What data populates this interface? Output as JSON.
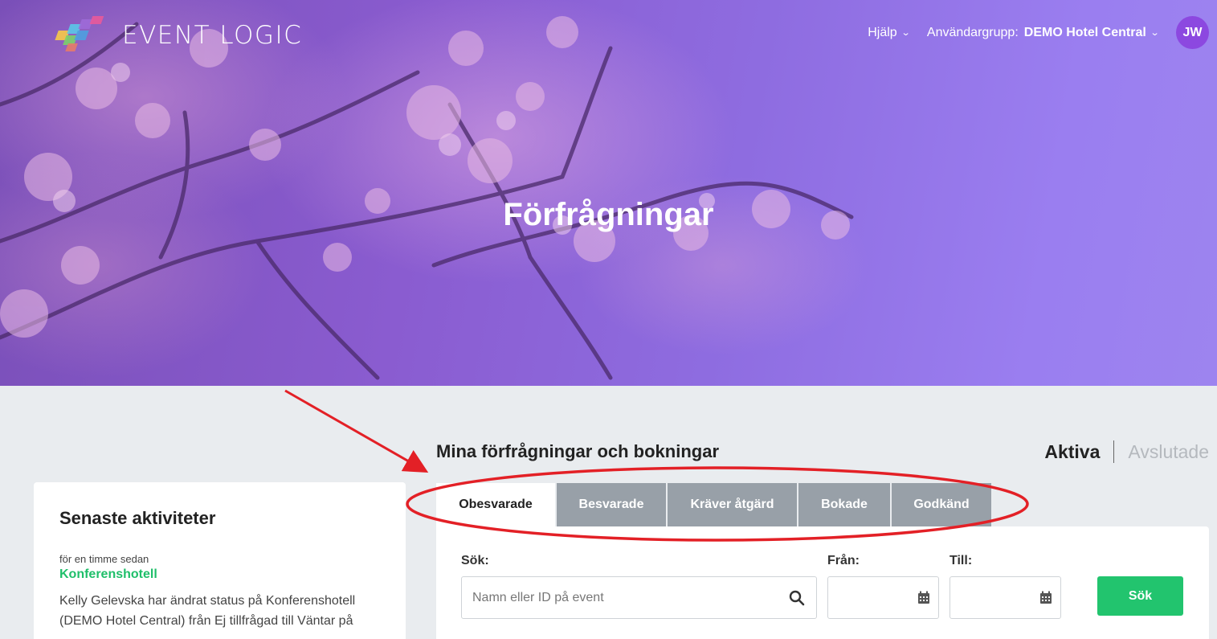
{
  "brand": {
    "name": "EVENT LOGIC",
    "logo_colors": [
      "#f7c948",
      "#5ac8e8",
      "#9d6ad8",
      "#e85a9a",
      "#7bd36a"
    ]
  },
  "topnav": {
    "help_label": "Hjälp",
    "user_group_label": "Användargrupp:",
    "user_group_value": "DEMO Hotel Central",
    "avatar_initials": "JW"
  },
  "hero": {
    "title": "Förfrågningar"
  },
  "activity": {
    "title": "Senaste aktiviteter",
    "items": [
      {
        "time": "för en timme sedan",
        "link": "Konferenshotell",
        "description": "Kelly Gelevska har ändrat status på Konferenshotell (DEMO Hotel Central) från Ej tillfrågad till Väntar på"
      }
    ]
  },
  "main": {
    "title": "Mina förfrågningar och bokningar",
    "status_active": "Aktiva",
    "status_inactive": "Avslutade",
    "tabs": [
      {
        "label": "Obesvarade",
        "selected": true
      },
      {
        "label": "Besvarade",
        "selected": false
      },
      {
        "label": "Kräver åtgärd",
        "selected": false
      },
      {
        "label": "Bokade",
        "selected": false
      },
      {
        "label": "Godkänd",
        "selected": false
      }
    ],
    "search": {
      "label": "Sök:",
      "placeholder": "Namn eller ID på event",
      "value": ""
    },
    "from": {
      "label": "Från:",
      "value": ""
    },
    "to": {
      "label": "Till:",
      "value": ""
    },
    "search_button": "Sök"
  },
  "colors": {
    "accent_green": "#22c46e",
    "tab_inactive": "#98a0a8",
    "avatar": "#8c48e0",
    "annotation_red": "#e32026"
  }
}
